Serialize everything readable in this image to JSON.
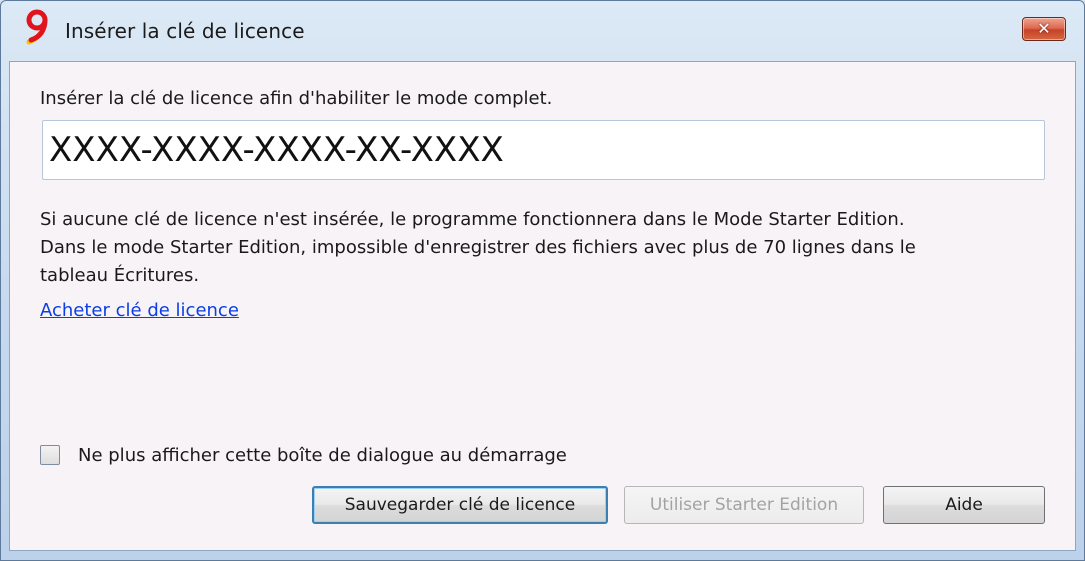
{
  "window": {
    "title": "Insérer la clé de licence",
    "app_icon": "banana-9-logo-icon",
    "close_icon": "close-icon",
    "close_glyph": "✕"
  },
  "dialog": {
    "prompt": "Insérer la clé de licence afin d'habiliter le mode complet.",
    "license_key": {
      "value": "XXXX-XXXX-XXXX-XX-XXXX",
      "placeholder": ""
    },
    "info_lines": [
      "Si aucune clé de licence n'est insérée, le programme fonctionnera dans le Mode Starter Edition.",
      "Dans le mode Starter Edition, impossible d'enregistrer des fichiers avec plus de 70 lignes dans le",
      "tableau Écritures."
    ],
    "buy_link": "Acheter clé de licence",
    "dont_show_checkbox": {
      "label": "Ne plus afficher cette boîte de dialogue au démarrage",
      "checked": false
    }
  },
  "buttons": {
    "save": "Sauvegarder clé de licence",
    "starter": "Utiliser Starter Edition",
    "starter_enabled": false,
    "help": "Aide"
  },
  "colors": {
    "logo_red": "#e0141e",
    "logo_yellow": "#f2c400",
    "link": "#0a3ee6",
    "focus_border": "#3c7fb1",
    "close_button": "#c5432a"
  }
}
